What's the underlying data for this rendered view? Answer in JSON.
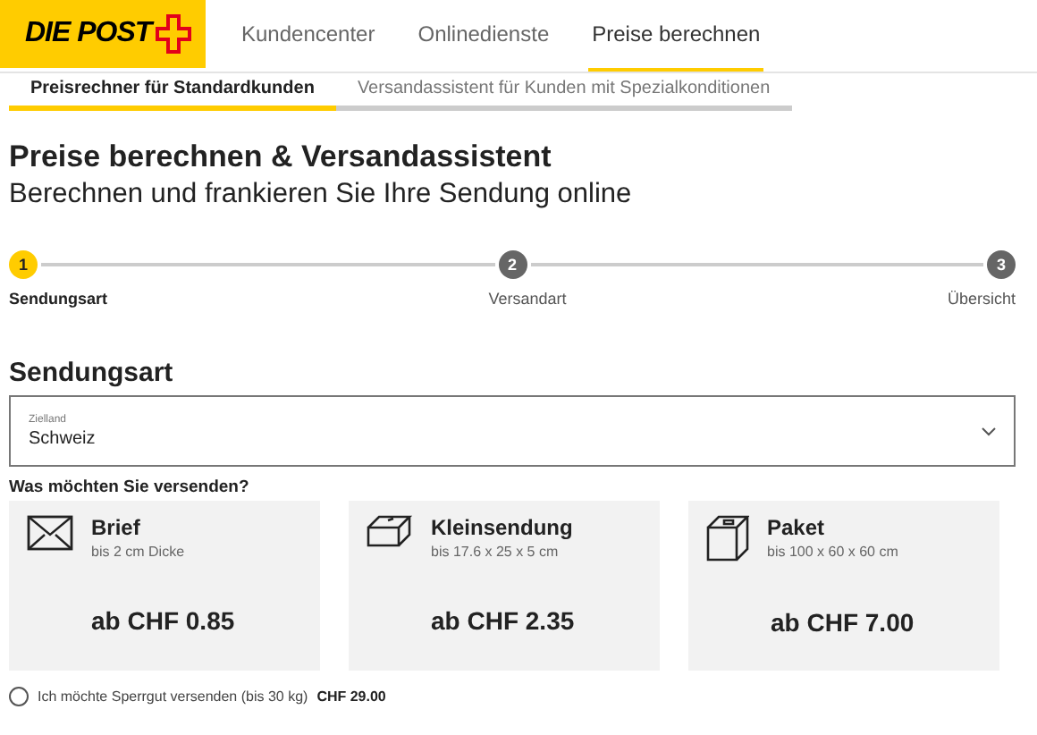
{
  "header": {
    "logo": "DIE POST",
    "nav": [
      {
        "label": "Kundencenter",
        "selected": false
      },
      {
        "label": "Onlinedienste",
        "selected": false
      },
      {
        "label": "Preise berechnen",
        "selected": true
      }
    ]
  },
  "sub_tabs": [
    {
      "label": "Preisrechner für Standardkunden",
      "selected": true
    },
    {
      "label": "Versandassistent für Kunden mit Spezialkonditionen",
      "selected": false
    }
  ],
  "title": "Preise berechnen & Versandassistent",
  "subtitle": "Berechnen und frankieren Sie Ihre Sendung online",
  "steps": [
    {
      "number": "1",
      "label": "Sendungsart",
      "selected": true
    },
    {
      "number": "2",
      "label": "Versandart",
      "selected": false
    },
    {
      "number": "3",
      "label": "Übersicht",
      "selected": false
    }
  ],
  "section_title": "Sendungsart",
  "destination": {
    "label": "Zielland",
    "value": "Schweiz"
  },
  "question": "Was möchten Sie versenden?",
  "options": [
    {
      "kind": "letter",
      "title": "Brief",
      "limit": "bis 2 cm Dicke",
      "price": "ab CHF 0.85"
    },
    {
      "kind": "small-parcel",
      "title": "Kleinsendung",
      "limit": "bis 17.6 x 25 x 5 cm",
      "price": "ab CHF 2.35"
    },
    {
      "kind": "parcel",
      "title": "Paket",
      "limit": "bis 100 x 60 x 60 cm",
      "price": "ab CHF 7.00"
    }
  ],
  "bulky": {
    "label": "Ich möchte Sperrgut versenden (bis 30 kg)",
    "price": "CHF 29.00",
    "checked": false
  }
}
